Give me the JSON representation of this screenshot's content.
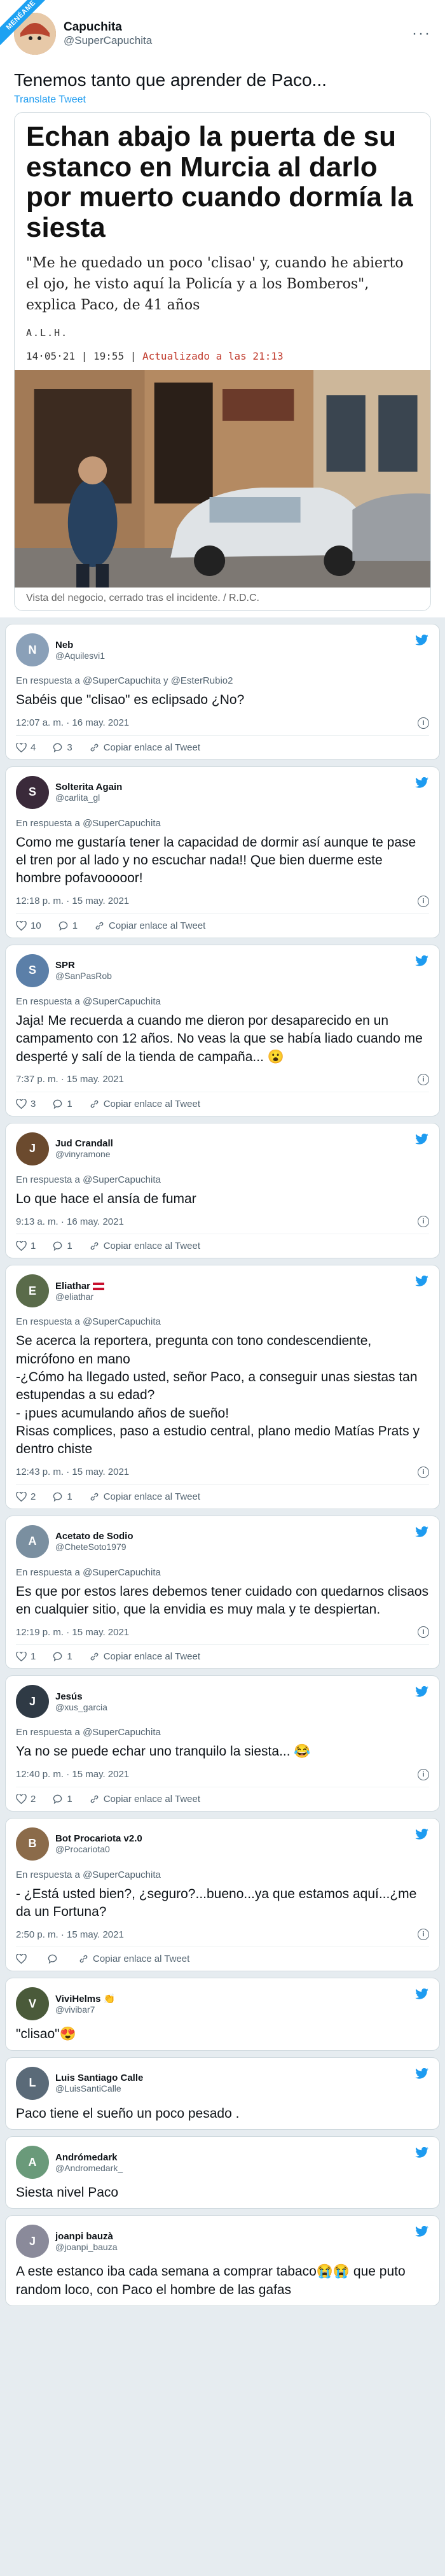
{
  "ribbon": "MENÉAME",
  "main_tweet": {
    "display_name": "Capuchita",
    "handle": "@SuperCapuchita",
    "text": "Tenemos tanto que aprender de Paco...",
    "translate": "Translate Tweet",
    "article": {
      "title": "Echan abajo la puerta de su estanco en Murcia al darlo por muerto cuando dormía la siesta",
      "subtitle": "\"Me he quedado un poco 'clisao' y, cuando he abierto el ojo, he visto aquí la Policía y a los Bomberos\", explica Paco, de 41 años",
      "author": "A.L.H.",
      "date": "14·05·21 | 19:55 |",
      "updated": "Actualizado a las 21:13",
      "caption": "Vista del negocio, cerrado tras el incidente.  / R.D.C."
    }
  },
  "replies": [
    {
      "name": "Neb",
      "handle": "@Aquilesvi1",
      "in_reply": "En respuesta a @SuperCapuchita y @EsterRubio2",
      "text": "Sabéis que \"clisao\" es eclipsado ¿No?",
      "time": "12:07 a. m. · 16 may. 2021",
      "likes": "4",
      "replies": "3",
      "copy": "Copiar enlace al Tweet",
      "color": "#8aa0b8",
      "initial": "N"
    },
    {
      "name": "Solterita Again",
      "handle": "@carlita_gl",
      "in_reply": "En respuesta a @SuperCapuchita",
      "text": "Como me gustaría tener la capacidad de dormir así aunque te pase el tren por al lado y no escuchar nada!! Que bien duerme este hombre pofavooooor!",
      "time": "12:18 p. m. · 15 may. 2021",
      "likes": "10",
      "replies": "1",
      "copy": "Copiar enlace al Tweet",
      "color": "#3a2a3a",
      "initial": "S"
    },
    {
      "name": "SPR",
      "handle": "@SanPasRob",
      "in_reply": "En respuesta a @SuperCapuchita",
      "text": "Jaja! Me recuerda a cuando me dieron por desaparecido en un campamento con 12 años. No veas la que se había liado cuando me desperté y salí de la tienda de campaña... 😮",
      "time": "7:37 p. m. · 15 may. 2021",
      "likes": "3",
      "replies": "1",
      "copy": "Copiar enlace al Tweet",
      "color": "#5b7fa8",
      "initial": "S"
    },
    {
      "name": "Jud Crandall",
      "handle": "@vinyramone",
      "in_reply": "En respuesta a @SuperCapuchita",
      "text": "Lo que hace el ansía de fumar",
      "time": "9:13 a. m. · 16 may. 2021",
      "likes": "1",
      "replies": "1",
      "copy": "Copiar enlace al Tweet",
      "color": "#6b4a2e",
      "initial": "J"
    },
    {
      "name": "Eliathar",
      "handle": "@eliathar",
      "in_reply": "En respuesta a @SuperCapuchita",
      "text": "Se acerca la reportera, pregunta con tono condescendiente, micrófono en mano\n-¿Cómo ha llegado usted, señor Paco, a conseguir unas siestas tan estupendas a su edad?\n- ¡pues acumulando años de sueño!\nRisas complices, paso a estudio central, plano medio Matías Prats y dentro chiste",
      "time": "12:43 p. m. · 15 may. 2021",
      "likes": "2",
      "replies": "1",
      "copy": "Copiar enlace al Tweet",
      "color": "#5a6b4a",
      "initial": "E"
    },
    {
      "name": "Acetato de Sodio",
      "handle": "@CheteSoto1979",
      "in_reply": "En respuesta a @SuperCapuchita",
      "text": "Es que por estos lares debemos tener cuidado con quedarnos clisaos en cualquier sitio, que la envidia es muy mala y te despiertan.",
      "time": "12:19 p. m. · 15 may. 2021",
      "likes": "1",
      "replies": "1",
      "copy": "Copiar enlace al Tweet",
      "color": "#7a8fa0",
      "initial": "A"
    },
    {
      "name": "Jesús",
      "handle": "@xus_garcia",
      "in_reply": "En respuesta a @SuperCapuchita",
      "text": "Ya no se puede echar uno tranquilo la siesta... 😂",
      "time": "12:40 p. m. · 15 may. 2021",
      "likes": "2",
      "replies": "1",
      "copy": "Copiar enlace al Tweet",
      "color": "#2f3a45",
      "initial": "J"
    },
    {
      "name": "Bot Procariota v2.0",
      "handle": "@Procariota0",
      "in_reply": "En respuesta a @SuperCapuchita",
      "text": "- ¿Está usted bien?, ¿seguro?...bueno...ya que estamos aquí...¿me da un Fortuna?",
      "time": "2:50 p. m. · 15 may. 2021",
      "likes": "",
      "replies": "",
      "copy": "Copiar enlace al Tweet",
      "color": "#8b6b4a",
      "initial": "B"
    },
    {
      "name": "ViviHelms 👏",
      "handle": "@vivibar7",
      "in_reply": "",
      "text": "\"clisao\"😍",
      "time": "",
      "likes": "",
      "replies": "",
      "copy": "",
      "color": "#4a5a3a",
      "initial": "V"
    },
    {
      "name": "Luis Santiago Calle",
      "handle": "@LuisSantiCalle",
      "in_reply": "",
      "text": "Paco tiene el sueño un poco pesado .",
      "time": "",
      "likes": "",
      "replies": "",
      "copy": "",
      "color": "#5a6a78",
      "initial": "L"
    },
    {
      "name": "Andrómedark",
      "handle": "@Andromedark_",
      "in_reply": "",
      "text": "Siesta nivel Paco",
      "time": "",
      "likes": "",
      "replies": "",
      "copy": "",
      "color": "#6a9a7a",
      "initial": "A"
    },
    {
      "name": "joanpi bauzà",
      "handle": "@joanpi_bauza",
      "in_reply": "",
      "text": "A este estanco iba cada semana a comprar tabaco😭😭 que puto random loco, con Paco el hombre de las gafas",
      "time": "",
      "likes": "",
      "replies": "",
      "copy": "",
      "color": "#8a8a9a",
      "initial": "J"
    }
  ]
}
